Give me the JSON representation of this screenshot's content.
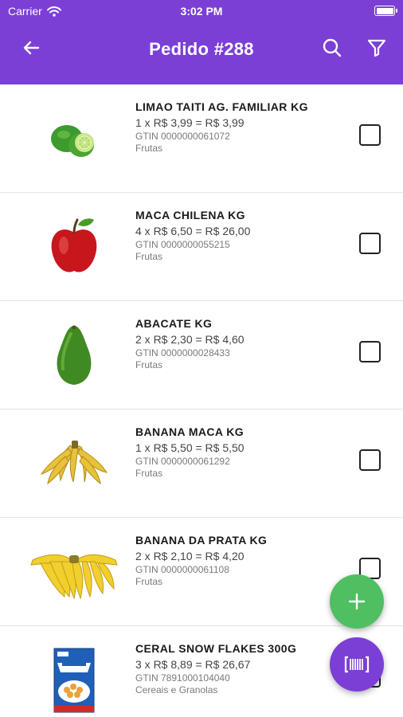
{
  "status_bar": {
    "carrier": "Carrier",
    "time": "3:02 PM"
  },
  "header": {
    "title": "Pedido #288",
    "back_icon": "back-arrow-icon",
    "search_icon": "search-icon",
    "filter_icon": "filter-icon"
  },
  "colors": {
    "primary": "#7b3fd6",
    "fab_add": "#4fbf62",
    "divider": "#e3e3e3"
  },
  "items": [
    {
      "name": "LIMAO TAITI AG. FAMILIAR KG",
      "price": "1 x R$ 3,99 = R$ 3,99",
      "gtin": "GTIN 0000000061072",
      "category": "Frutas",
      "image_icon": "lime-icon",
      "checked": false
    },
    {
      "name": "MACA CHILENA KG",
      "price": "4 x R$ 6,50 = R$ 26,00",
      "gtin": "GTIN 0000000055215",
      "category": "Frutas",
      "image_icon": "apple-icon",
      "checked": false
    },
    {
      "name": "ABACATE KG",
      "price": "2 x R$ 2,30 = R$ 4,60",
      "gtin": "GTIN 0000000028433",
      "category": "Frutas",
      "image_icon": "avocado-icon",
      "checked": false
    },
    {
      "name": "BANANA MACA  KG",
      "price": "1 x R$ 5,50 = R$ 5,50",
      "gtin": "GTIN 0000000061292",
      "category": "Frutas",
      "image_icon": "banana-icon",
      "checked": false
    },
    {
      "name": "BANANA DA PRATA KG",
      "price": "2 x R$ 2,10 = R$ 4,20",
      "gtin": "GTIN 0000000061108",
      "category": "Frutas",
      "image_icon": "banana-bunch-icon",
      "checked": false
    },
    {
      "name": "CERAL SNOW FLAKES 300G",
      "price": "3 x R$ 8,89 = R$ 26,67",
      "gtin": "GTIN 7891000104040",
      "category": "Cereais e Granolas",
      "image_icon": "cereal-box-icon",
      "checked": false
    }
  ],
  "fabs": {
    "add_icon": "plus-icon",
    "scan_icon": "barcode-scan-icon"
  }
}
